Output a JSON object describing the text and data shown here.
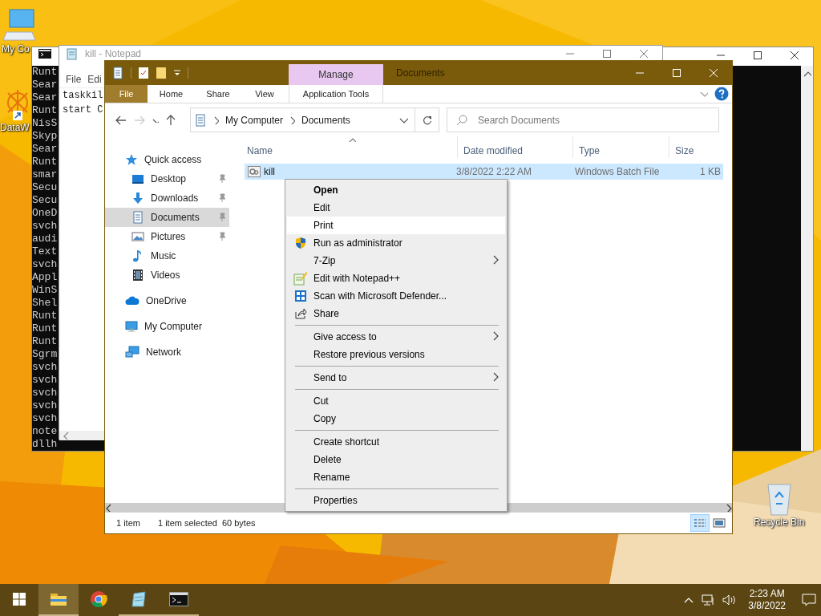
{
  "desktop_icons": [
    {
      "kind": "computer",
      "label": "My Co"
    },
    {
      "kind": "app",
      "label": "DataW"
    },
    {
      "kind": "recycle",
      "label": "Recycle Bin"
    }
  ],
  "console": {
    "lines": [
      "Runt",
      "Sear",
      "Sear",
      "Runt",
      "NisS",
      "Skyp",
      "Sear",
      "Runt",
      "smar",
      "Secu",
      "Secu",
      "OneD",
      "svch",
      "audi",
      "Text",
      "svch",
      "Appl",
      "WinS",
      "Shel",
      "Runt",
      "Runt",
      "Runt",
      "Sgrm",
      "svch",
      "svch",
      "svch",
      "svch",
      "svch",
      "note",
      "dllh"
    ]
  },
  "notepad": {
    "title": "kill - Notepad",
    "menu": [
      "File",
      "Edi"
    ],
    "lines": [
      "taskkil",
      "start C"
    ]
  },
  "explorer": {
    "title": "Documents",
    "context_header": "Manage",
    "ribbon_tabs": [
      {
        "label": "File",
        "kind": "file"
      },
      {
        "label": "Home",
        "kind": "tab"
      },
      {
        "label": "Share",
        "kind": "tab"
      },
      {
        "label": "View",
        "kind": "tab"
      },
      {
        "label": "Application Tools",
        "kind": "context"
      }
    ],
    "address": [
      "My Computer",
      "Documents"
    ],
    "search": {
      "placeholder": "Search Documents"
    },
    "nav": [
      {
        "label": "Quick access",
        "kind": "star",
        "pinned": false,
        "selected": false,
        "children": [
          {
            "label": "Desktop",
            "kind": "desktop",
            "pinned": true,
            "selected": false
          },
          {
            "label": "Downloads",
            "kind": "download",
            "pinned": true,
            "selected": false
          },
          {
            "label": "Documents",
            "kind": "document",
            "pinned": true,
            "selected": true
          },
          {
            "label": "Pictures",
            "kind": "pictures",
            "pinned": true,
            "selected": false
          },
          {
            "label": "Music",
            "kind": "music",
            "pinned": false,
            "selected": false
          },
          {
            "label": "Videos",
            "kind": "videos",
            "pinned": false,
            "selected": false
          }
        ]
      },
      {
        "label": "OneDrive",
        "kind": "cloud",
        "pinned": false,
        "selected": false
      },
      {
        "label": "My Computer",
        "kind": "computer",
        "pinned": false,
        "selected": false
      },
      {
        "label": "Network",
        "kind": "network",
        "pinned": false,
        "selected": false
      }
    ],
    "columns": [
      {
        "label": "Name",
        "sorted": true
      },
      {
        "label": "Date modified",
        "sorted": false
      },
      {
        "label": "Type",
        "sorted": false
      },
      {
        "label": "Size",
        "sorted": false
      }
    ],
    "files": [
      {
        "name": "kill",
        "date": "3/8/2022 2:22 AM",
        "type": "Windows Batch File",
        "size": "1 KB",
        "selected": true
      }
    ],
    "status": [
      "1 item",
      "1 item selected",
      "60 bytes"
    ],
    "view_buttons": [
      {
        "kind": "details",
        "selected": true
      },
      {
        "kind": "tiles",
        "selected": false
      }
    ]
  },
  "context_menu": {
    "groups": [
      [
        {
          "label": "Open",
          "default": true,
          "highlighted": false,
          "kind": "plain",
          "submenu": false
        },
        {
          "label": "Edit",
          "default": false,
          "highlighted": false,
          "kind": "plain",
          "submenu": false
        },
        {
          "label": "Print",
          "default": false,
          "highlighted": true,
          "kind": "plain",
          "submenu": false
        },
        {
          "label": "Run as administrator",
          "default": false,
          "highlighted": false,
          "kind": "shield",
          "submenu": false
        },
        {
          "label": "7-Zip",
          "default": false,
          "highlighted": false,
          "kind": "plain",
          "submenu": true
        },
        {
          "label": "Edit with Notepad++",
          "default": false,
          "highlighted": false,
          "kind": "notepad",
          "submenu": false
        },
        {
          "label": "Scan with Microsoft Defender...",
          "default": false,
          "highlighted": false,
          "kind": "defender",
          "submenu": false
        },
        {
          "label": "Share",
          "default": false,
          "highlighted": false,
          "kind": "share",
          "submenu": false
        }
      ],
      [
        {
          "label": "Give access to",
          "default": false,
          "highlighted": false,
          "kind": "plain",
          "submenu": true
        },
        {
          "label": "Restore previous versions",
          "default": false,
          "highlighted": false,
          "kind": "plain",
          "submenu": false
        }
      ],
      [
        {
          "label": "Send to",
          "default": false,
          "highlighted": false,
          "kind": "plain",
          "submenu": true
        }
      ],
      [
        {
          "label": "Cut",
          "default": false,
          "highlighted": false,
          "kind": "plain",
          "submenu": false
        },
        {
          "label": "Copy",
          "default": false,
          "highlighted": false,
          "kind": "plain",
          "submenu": false
        }
      ],
      [
        {
          "label": "Create shortcut",
          "default": false,
          "highlighted": false,
          "kind": "plain",
          "submenu": false
        },
        {
          "label": "Delete",
          "default": false,
          "highlighted": false,
          "kind": "plain",
          "submenu": false
        },
        {
          "label": "Rename",
          "default": false,
          "highlighted": false,
          "kind": "plain",
          "submenu": false
        }
      ],
      [
        {
          "label": "Properties",
          "default": false,
          "highlighted": false,
          "kind": "plain",
          "submenu": false
        }
      ]
    ]
  },
  "taskbar": {
    "apps": [
      {
        "kind": "explorer",
        "running": true,
        "active": true
      },
      {
        "kind": "chrome",
        "running": false,
        "active": false
      },
      {
        "kind": "notepad",
        "running": true,
        "active": false
      },
      {
        "kind": "console",
        "running": true,
        "active": false
      }
    ],
    "time": "2:23 AM",
    "date": "3/8/2022"
  }
}
